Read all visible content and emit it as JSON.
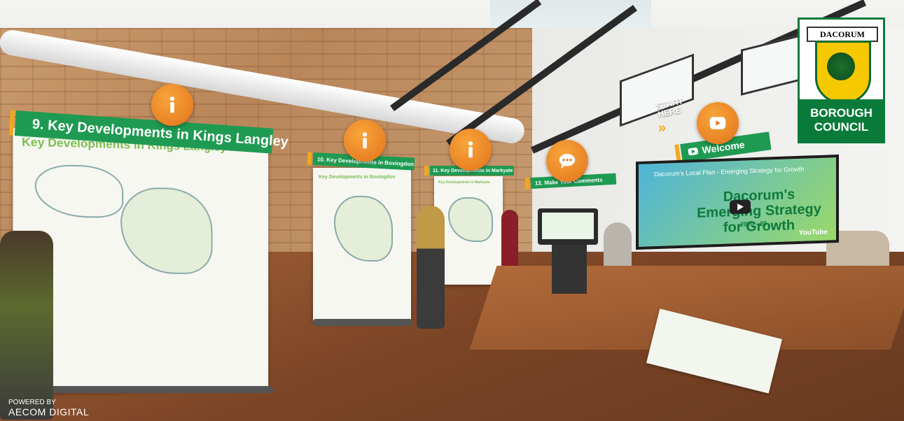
{
  "banners": {
    "b9": "9. Key Developments in Kings Langley",
    "b10": "10. Key Developments in Bovingdon",
    "b11": "11. Key Developments in Markyate",
    "b12": "12. Make Your Comments",
    "welcome": "Welcome"
  },
  "boards": {
    "board9_title": "Key Developments in Kings Langley",
    "board10_title": "Key Developments in Bovingdon",
    "board11_title": "Key Developments in Markyate"
  },
  "video": {
    "header": "Dacorum's Local Plan - Emerging Strategy for Growth",
    "title": "Dacorum's Emerging Strategy for Growth",
    "years": "2020 - 20",
    "platform": "YouTube"
  },
  "start": {
    "line1": "START",
    "line2": "HERE",
    "chevrons": "»"
  },
  "logo": {
    "ribbon": "DACORUM",
    "line1": "BOROUGH",
    "line2": "COUNCIL"
  },
  "footer": {
    "powered_by": "POWERED BY",
    "brand": "AECOM DIGITAL"
  },
  "colors": {
    "hotspot": "#e3731a",
    "banner": "#1f9a52",
    "accent": "#f2a81d"
  }
}
